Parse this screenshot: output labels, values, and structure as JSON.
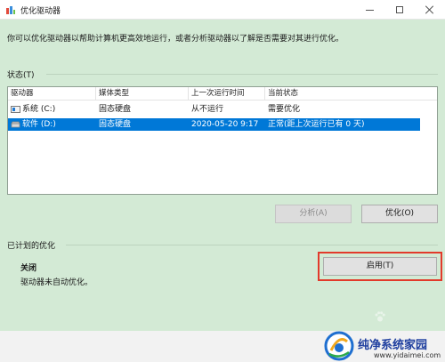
{
  "window": {
    "title": "优化驱动器"
  },
  "intro_text": "你可以优化驱动器以帮助计算机更高效地运行，或者分析驱动器以了解是否需要对其进行优化。",
  "status_section": {
    "label": "状态(T)",
    "columns": [
      "驱动器",
      "媒体类型",
      "上一次运行时间",
      "当前状态"
    ],
    "drives": [
      {
        "name": "系统 (C:)",
        "media": "固态硬盘",
        "last_run": "从不运行",
        "status": "需要优化",
        "selected": false,
        "icon": "windows-drive-icon"
      },
      {
        "name": "软件 (D:)",
        "media": "固态硬盘",
        "last_run": "2020-05-20 9:17",
        "status": "正常(距上次运行已有 0 天)",
        "selected": true,
        "icon": "drive-icon"
      }
    ]
  },
  "buttons": {
    "analyze": "分析(A)",
    "optimize": "优化(O)",
    "enable": "启用(T)"
  },
  "scheduled_section": {
    "label": "已计划的优化",
    "status_title": "关闭",
    "status_desc": "驱动器未自动优化。"
  },
  "watermark": {
    "text": "纯净系统家园",
    "url": "www.yidaimei.com"
  },
  "colors": {
    "window_bg": "#d3ead5",
    "selection": "#0078d7",
    "highlight": "#e23a2b"
  }
}
